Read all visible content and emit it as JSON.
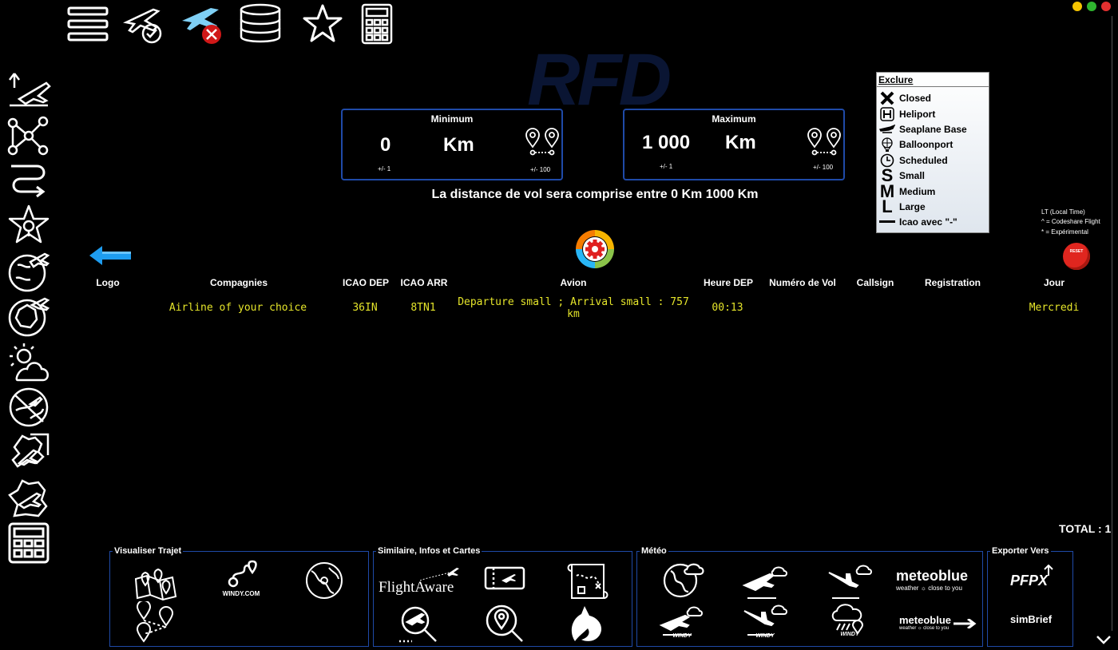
{
  "window_controls": {
    "minimize_color": "#f5c400",
    "maximize_color": "#2fb52f",
    "close_color": "#e23030"
  },
  "watermark": "RFD",
  "top_toolbar": [
    "menu-icon",
    "flight-validated-icon",
    "flight-cancelled-icon",
    "database-icon",
    "star-icon",
    "calculator-icon"
  ],
  "left_toolbar": [
    "departure-icon",
    "network-nodes-icon",
    "route-path-icon",
    "favorites-icon",
    "world-flight-icon",
    "france-flight-icon",
    "weather-icon",
    "world-routes-icon",
    "europe-flight-icon",
    "france-map-icon",
    "calculator-icon"
  ],
  "distance": {
    "minimum": {
      "title": "Minimum",
      "value": "0",
      "unit": "Km",
      "step_small": "+/- 1",
      "step_big": "+/- 100"
    },
    "maximum": {
      "title": "Maximum",
      "value": "1 000",
      "unit": "Km",
      "step_small": "+/- 1",
      "step_big": "+/- 100"
    },
    "sentence": "La distance de vol sera comprise entre 0 Km 1000 Km"
  },
  "exclure": {
    "title": "Exclure",
    "items": [
      {
        "label": "Closed",
        "icon": "close-x-icon"
      },
      {
        "label": "Heliport",
        "icon": "heliport-icon"
      },
      {
        "label": "Seaplane Base",
        "icon": "seaplane-icon"
      },
      {
        "label": "Balloonport",
        "icon": "balloon-icon"
      },
      {
        "label": "Scheduled",
        "icon": "clock-icon"
      },
      {
        "label": "Small",
        "icon": "letter-s-icon"
      },
      {
        "label": "Medium",
        "icon": "letter-m-icon"
      },
      {
        "label": "Large",
        "icon": "letter-l-icon"
      },
      {
        "label": "Icao avec \"-\"",
        "icon": "dash-icon"
      }
    ]
  },
  "legend": [
    "LT (Local Time)",
    "^ = Codeshare Flight",
    "* = Expérimental"
  ],
  "reset_label": "RESET",
  "table": {
    "headers": {
      "logo": "Logo",
      "companies": "Compagnies",
      "icao_dep": "ICAO DEP",
      "icao_arr": "ICAO ARR",
      "aircraft": "Avion",
      "dep_time": "Heure DEP",
      "flight_number": "Numéro de Vol",
      "callsign": "Callsign",
      "registration": "Registration",
      "day": "Jour"
    },
    "rows": [
      {
        "company": "Airline of your choice",
        "icao_dep": "36IN",
        "icao_arr": "8TN1",
        "aircraft_line1": "Departure small ; Arrival small : 757",
        "aircraft_line2": "km",
        "dep_time": "00:13",
        "flight_number": "",
        "callsign": "",
        "registration": "",
        "day": "Mercredi"
      }
    ]
  },
  "total": "TOTAL : 1",
  "panels": {
    "visualiser": {
      "label": "Visualiser Trajet",
      "windy": "WINDY.COM"
    },
    "similaire": {
      "label": "Similaire, Infos et Cartes",
      "flightaware": "FlightAware"
    },
    "meteo": {
      "label": "Météo",
      "meteoblue": "meteoblue",
      "meteoblue_sub": "weather ☼ close to you",
      "windy": "WINDY"
    },
    "exporter": {
      "label": "Exporter Vers",
      "pfpx": "PFPX",
      "simbrief": "simBrief"
    }
  },
  "colors": {
    "panel_border": "#1f4aa8",
    "table_text": "#e5e52a",
    "accent_blue": "#2a8ef0"
  }
}
